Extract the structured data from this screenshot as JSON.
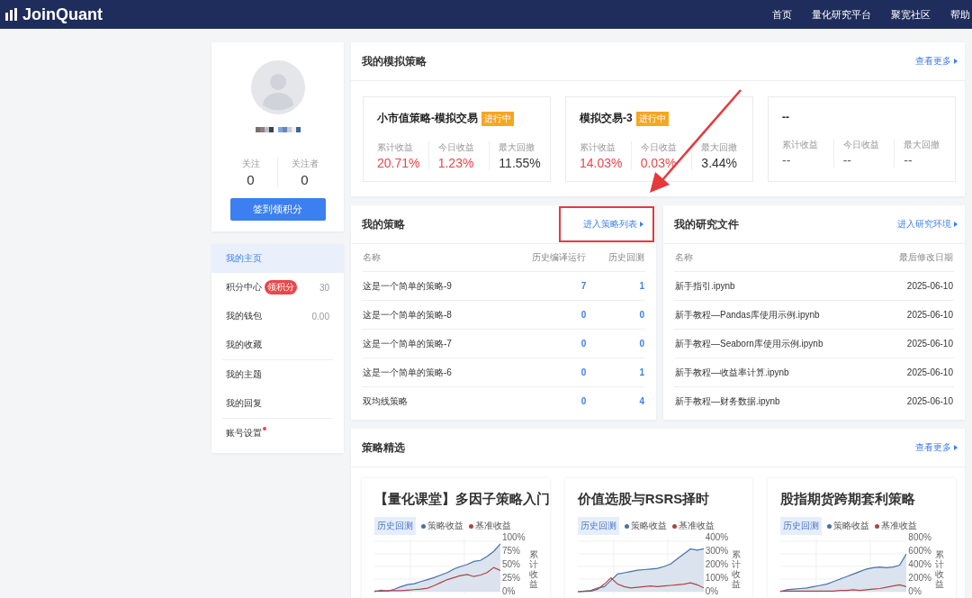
{
  "nav": {
    "logo": "JoinQuant",
    "links": [
      "首页",
      "量化研究平台",
      "聚宽社区",
      "帮助"
    ]
  },
  "profile": {
    "stats": [
      {
        "label": "关注",
        "value": "0"
      },
      {
        "label": "关注者",
        "value": "0"
      }
    ],
    "checkin_button": "签到领积分"
  },
  "menu": {
    "groups": [
      [
        {
          "label": "我的主页",
          "selected": true
        },
        {
          "label": "积分中心",
          "selected": false,
          "badge": "领积分",
          "value": "30"
        },
        {
          "label": "我的钱包",
          "selected": false,
          "value": "0.00"
        },
        {
          "label": "我的收藏",
          "selected": false
        }
      ],
      [
        {
          "label": "我的主题",
          "selected": false
        },
        {
          "label": "我的回复",
          "selected": false
        }
      ],
      [
        {
          "label": "账号设置",
          "selected": false,
          "dot": true
        }
      ]
    ]
  },
  "simulations": {
    "title": "我的模拟策略",
    "more": "查看更多",
    "cards": [
      {
        "name": "小市值策略-模拟交易",
        "status": "进行中",
        "stats": [
          {
            "label": "累计收益",
            "value": "20.71%",
            "color": "#e9474b"
          },
          {
            "label": "今日收益",
            "value": "1.23%",
            "color": "#e9474b"
          },
          {
            "label": "最大回撤",
            "value": "11.55%",
            "color": "#333333"
          }
        ]
      },
      {
        "name": "模拟交易-3",
        "status": "进行中",
        "stats": [
          {
            "label": "累计收益",
            "value": "14.03%",
            "color": "#e9474b"
          },
          {
            "label": "今日收益",
            "value": "0.03%",
            "color": "#e9474b"
          },
          {
            "label": "最大回撤",
            "value": "3.44%",
            "color": "#333333"
          }
        ]
      },
      {
        "name": "--",
        "stats": [
          {
            "label": "累计收益",
            "value": "--",
            "color": "#666666"
          },
          {
            "label": "今日收益",
            "value": "--",
            "color": "#666666"
          },
          {
            "label": "最大回撤",
            "value": "--",
            "color": "#666666"
          }
        ]
      }
    ]
  },
  "strategies": {
    "title": "我的策略",
    "link": "进入策略列表",
    "highlighted": true,
    "columns": [
      "名称",
      "历史编译运行",
      "历史回测"
    ],
    "rows": [
      {
        "name": "这是一个简单的策略-9",
        "compiles": "7",
        "backtests": "1"
      },
      {
        "name": "这是一个简单的策略-8",
        "compiles": "0",
        "backtests": "0"
      },
      {
        "name": "这是一个简单的策略-7",
        "compiles": "0",
        "backtests": "0"
      },
      {
        "name": "这是一个简单的策略-6",
        "compiles": "0",
        "backtests": "1"
      },
      {
        "name": "双均线策略",
        "compiles": "0",
        "backtests": "4"
      }
    ]
  },
  "research": {
    "title": "我的研究文件",
    "link": "进入研究环境",
    "columns": [
      "名称",
      "最后修改日期"
    ],
    "rows": [
      {
        "name": "新手指引.ipynb",
        "date": "2025-06-10"
      },
      {
        "name": "新手教程—Pandas库使用示例.ipynb",
        "date": "2025-06-10"
      },
      {
        "name": "新手教程—Seaborn库使用示例.ipynb",
        "date": "2025-06-10"
      },
      {
        "name": "新手教程—收益率计算.ipynb",
        "date": "2025-06-10"
      },
      {
        "name": "新手教程—财务数据.ipynb",
        "date": "2025-06-10"
      }
    ]
  },
  "featured": {
    "title": "策略精选",
    "more": "查看更多",
    "cards": [
      {
        "title": "【量化课堂】多因子策略入门",
        "tag": "历史回测",
        "chart_data": {
          "type": "line",
          "grid": true,
          "ylabel": "累计收益",
          "ylim": [
            0,
            100
          ],
          "yticks": [
            {
              "value": 100,
              "label": "100%"
            },
            {
              "value": 75,
              "label": "75%"
            },
            {
              "value": 50,
              "label": "50%"
            },
            {
              "value": 25,
              "label": "25%"
            },
            {
              "value": 0,
              "label": "0%"
            }
          ],
          "series": [
            {
              "name": "策略收益",
              "color": "#4572a7",
              "values": [
                0,
                3,
                1,
                5,
                10,
                14,
                16,
                20,
                24,
                28,
                33,
                38,
                45,
                50,
                54,
                60,
                62,
                70,
                80,
                95
              ]
            },
            {
              "name": "基准收益",
              "color": "#aa4643",
              "values": [
                1,
                1,
                2,
                2,
                2,
                3,
                4,
                5,
                7,
                12,
                18,
                24,
                28,
                32,
                34,
                30,
                33,
                38,
                48,
                42
              ]
            }
          ]
        }
      },
      {
        "title": "价值选股与RSRS择时",
        "tag": "历史回测",
        "chart_data": {
          "type": "line",
          "grid": true,
          "ylabel": "累计收益",
          "ylim": [
            0,
            400
          ],
          "yticks": [
            {
              "value": 400,
              "label": "400%"
            },
            {
              "value": 300,
              "label": "300%"
            },
            {
              "value": 200,
              "label": "200%"
            },
            {
              "value": 100,
              "label": "100%"
            },
            {
              "value": 0,
              "label": "0%"
            }
          ],
          "series": [
            {
              "name": "策略收益",
              "color": "#4572a7",
              "values": [
                0,
                5,
                10,
                30,
                40,
                90,
                140,
                150,
                160,
                170,
                175,
                180,
                185,
                200,
                220,
                260,
                300,
                340,
                330,
                340
              ]
            },
            {
              "name": "基准收益",
              "color": "#aa4643",
              "values": [
                0,
                2,
                5,
                20,
                60,
                110,
                60,
                40,
                30,
                35,
                40,
                45,
                40,
                45,
                50,
                55,
                60,
                70,
                55,
                30
              ]
            }
          ]
        }
      },
      {
        "title": "股指期货跨期套利策略",
        "tag": "历史回测",
        "chart_data": {
          "type": "line",
          "grid": true,
          "ylabel": "累计收益",
          "ylim": [
            0,
            800
          ],
          "yticks": [
            {
              "value": 800,
              "label": "800%"
            },
            {
              "value": 600,
              "label": "600%"
            },
            {
              "value": 400,
              "label": "400%"
            },
            {
              "value": 200,
              "label": "200%"
            },
            {
              "value": 0,
              "label": "0%"
            }
          ],
          "series": [
            {
              "name": "策略收益",
              "color": "#4572a7",
              "values": [
                0,
                30,
                40,
                50,
                60,
                80,
                100,
                120,
                160,
                200,
                240,
                280,
                320,
                360,
                380,
                390,
                380,
                390,
                420,
                600
              ]
            },
            {
              "name": "基准收益",
              "color": "#aa4643",
              "values": [
                10,
                10,
                10,
                10,
                10,
                10,
                10,
                10,
                10,
                20,
                20,
                30,
                20,
                30,
                40,
                50,
                70,
                90,
                110,
                80
              ]
            }
          ]
        }
      }
    ]
  }
}
